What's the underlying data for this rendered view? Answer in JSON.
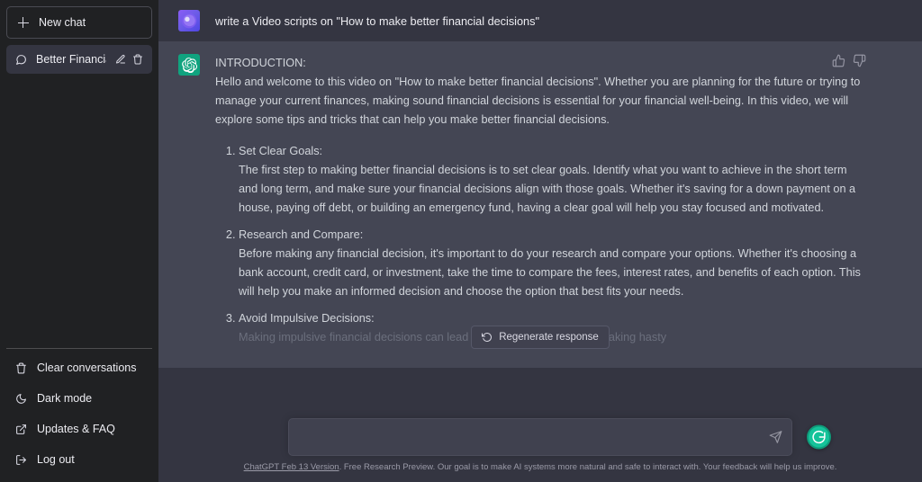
{
  "sidebar": {
    "new_chat_label": "New chat",
    "conversations": [
      {
        "title": "Better Financial Decisi",
        "edit_icon": "pencil-icon",
        "delete_icon": "trash-icon"
      }
    ],
    "bottom_items": [
      {
        "icon": "trash-icon",
        "label": "Clear conversations"
      },
      {
        "icon": "moon-icon",
        "label": "Dark mode"
      },
      {
        "icon": "external-link-icon",
        "label": "Updates & FAQ"
      },
      {
        "icon": "logout-icon",
        "label": "Log out"
      }
    ]
  },
  "conversation": {
    "user_message": "write a Video scripts on  \"How to make better financial decisions\"",
    "assistant": {
      "heading": "INTRODUCTION:",
      "lead": "Hello and welcome to this video on \"How to make better financial decisions\". Whether you are planning for the future or trying to manage your current finances, making sound financial decisions is essential for your financial well-being. In this video, we will explore some tips and tricks that can help you make better financial decisions.",
      "items": [
        {
          "title": "Set Clear Goals:",
          "body": "The first step to making better financial decisions is to set clear goals. Identify what you want to achieve in the short term and long term, and make sure your financial decisions align with those goals. Whether it's saving for a down payment on a house, paying off debt, or building an emergency fund, having a clear goal will help you stay focused and motivated."
        },
        {
          "title": "Research and Compare:",
          "body": "Before making any financial decision, it's important to do your research and compare your options. Whether it's choosing a bank account, credit card, or investment, take the time to compare the fees, interest rates, and benefits of each option. This will help you make an informed decision and choose the option that best fits your needs."
        },
        {
          "title": "Avoid Impulsive Decisions:",
          "body": "Making impulsive financial decisions can lead to costly mistakes. Avoid making hasty"
        }
      ]
    },
    "feedback": {
      "thumbs_up": "thumbs-up-icon",
      "thumbs_down": "thumbs-down-icon"
    }
  },
  "composer": {
    "value": "",
    "placeholder": "",
    "send_icon": "send-icon",
    "regenerate_label": "Regenerate response",
    "grammarly_label": "G"
  },
  "footer": {
    "version_link": "ChatGPT Feb 13 Version",
    "disclaimer": ". Free Research Preview. Our goal is to make AI systems more natural and safe to interact with. Your feedback will help us improve."
  },
  "colors": {
    "sidebar_bg": "#202123",
    "user_row_bg": "#343541",
    "bot_row_bg": "#444654",
    "accent_green": "#10a37f",
    "grammarly_green": "#15c39a"
  }
}
